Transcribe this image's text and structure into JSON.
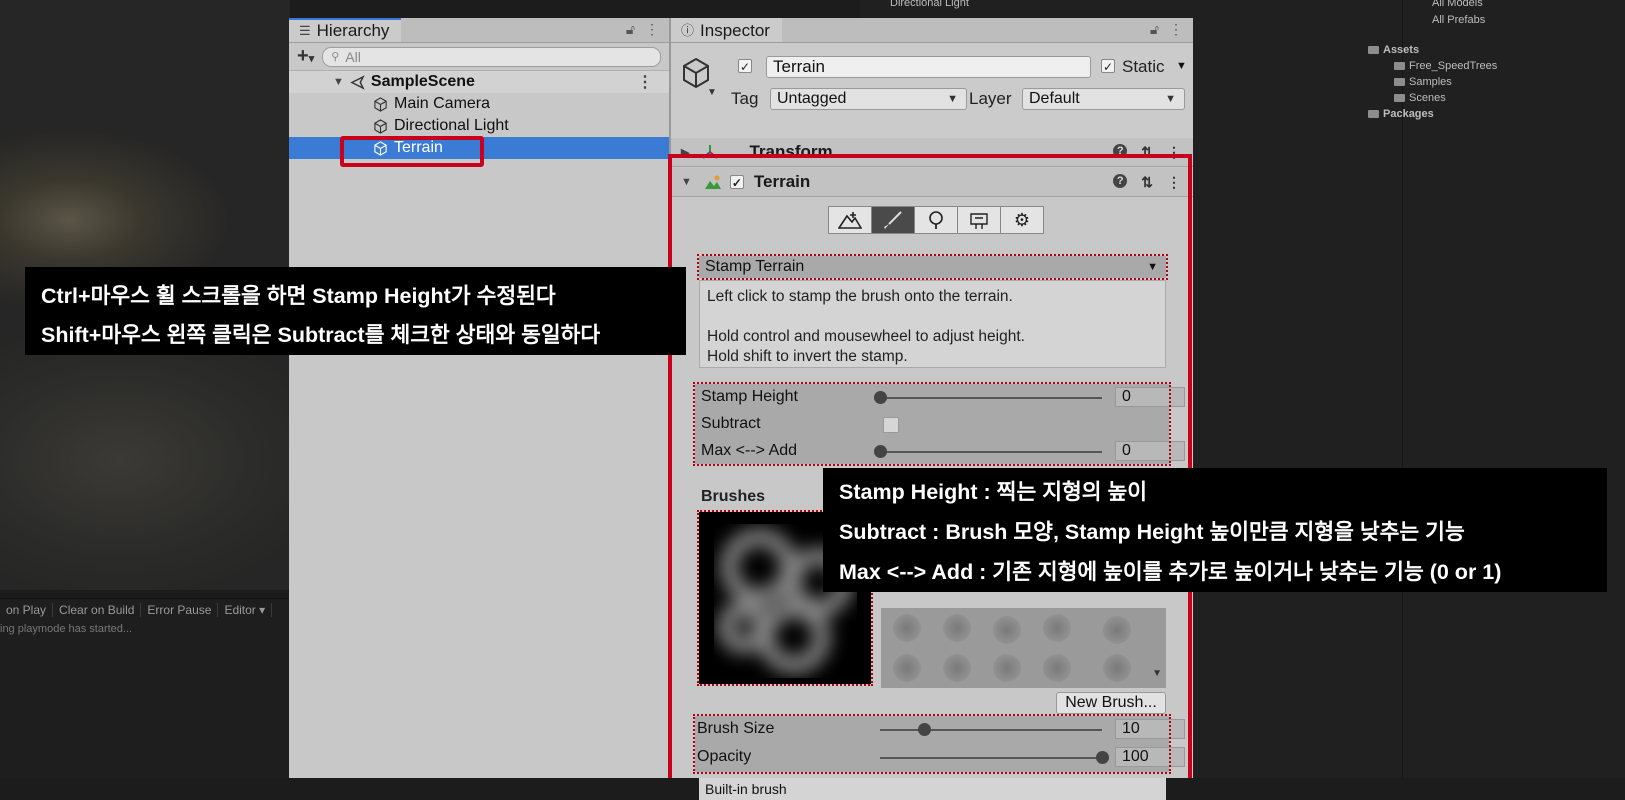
{
  "hierarchy": {
    "tab_label": "Hierarchy",
    "search_placeholder": "All",
    "scene_name": "SampleScene",
    "objects": [
      "Main Camera",
      "Directional Light",
      "Terrain"
    ],
    "selected": "Terrain"
  },
  "inspector": {
    "tab_label": "Inspector",
    "object_name": "Terrain",
    "static_label": "Static",
    "tag_label": "Tag",
    "tag_value": "Untagged",
    "layer_label": "Layer",
    "layer_value": "Default",
    "components": {
      "transform": "Transform",
      "terrain": "Terrain"
    },
    "paint_mode": "Stamp Terrain",
    "help_lines": [
      "Left click to stamp the brush onto the terrain.",
      "Hold control and mousewheel to adjust height.",
      "Hold shift to invert the stamp."
    ],
    "params": {
      "stamp_height_label": "Stamp Height",
      "stamp_height_value": "0",
      "stamp_height_level": 0,
      "subtract_label": "Subtract",
      "subtract_checked": false,
      "max_add_label": "Max <--> Add",
      "max_add_value": "0",
      "max_add_level": 0
    },
    "brushes_label": "Brushes",
    "new_brush_label": "New Brush...",
    "brush_size_label": "Brush Size",
    "brush_size_value": "10",
    "brush_size_level": 0.2,
    "opacity_label": "Opacity",
    "opacity_value": "100",
    "opacity_level": 1.0,
    "builtin_label": "Built-in brush"
  },
  "console": {
    "buttons": [
      "on Play",
      "Clear on Build",
      "Error Pause",
      "Editor ▾"
    ],
    "message": "ing playmode has started..."
  },
  "project": {
    "top_items": [
      "All Models",
      "All Prefabs",
      "Directional Light"
    ],
    "assets_label": "Assets",
    "folders": [
      "Free_SpeedTrees",
      "Samples",
      "Scenes"
    ],
    "packages_label": "Packages"
  },
  "captions": {
    "left": [
      "Ctrl+마우스 휠 스크롤을 하면 Stamp Height가 수정된다",
      "Shift+마우스 왼쪽 클릭은 Subtract를 체크한 상태와 동일하다"
    ],
    "right": [
      "Stamp Height : 찍는 지형의 높이",
      "Subtract : Brush 모양, Stamp Height 높이만큼 지형을 낮추는 기능",
      "Max <--> Add : 기존 지형에 높이를 추가로 높이거나 낮추는 기능 (0 or 1)"
    ]
  },
  "colors": {
    "highlight": "#c8001b",
    "selection": "#3a7bd5"
  }
}
